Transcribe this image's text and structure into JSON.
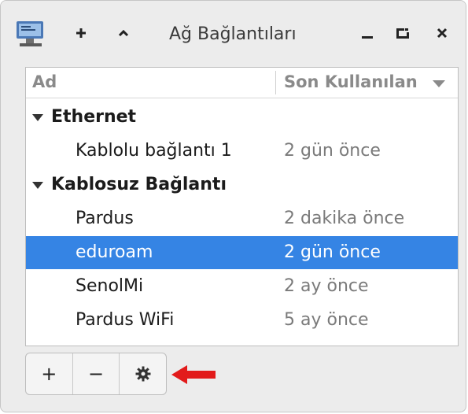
{
  "window": {
    "title": "Ağ Bağlantıları",
    "icons": {
      "app": "network-connections-icon",
      "add": "plus-icon",
      "up": "chevron-up-icon",
      "minimize": "minimize-icon",
      "maximize": "maximize-icon",
      "close": "close-icon"
    }
  },
  "header": {
    "name_col": "Ad",
    "last_used_col": "Son Kullanılan"
  },
  "groups": [
    {
      "name": "Ethernet",
      "items": [
        {
          "name": "Kablolu bağlantı 1",
          "last_used": "2 gün önce",
          "selected": false
        }
      ]
    },
    {
      "name": "Kablosuz Bağlantı",
      "items": [
        {
          "name": "Pardus",
          "last_used": "2 dakika önce",
          "selected": false
        },
        {
          "name": "eduroam",
          "last_used": "2 gün önce",
          "selected": true
        },
        {
          "name": "SenolMi",
          "last_used": "2 ay önce",
          "selected": false
        },
        {
          "name": "Pardus WiFi",
          "last_used": "5 ay önce",
          "selected": false
        }
      ]
    }
  ],
  "toolbar": {
    "add_label": "+",
    "remove_label": "−",
    "settings_icon": "gear-icon"
  },
  "colors": {
    "selection": "#3584e4",
    "annotation_arrow": "#e21b1b"
  }
}
